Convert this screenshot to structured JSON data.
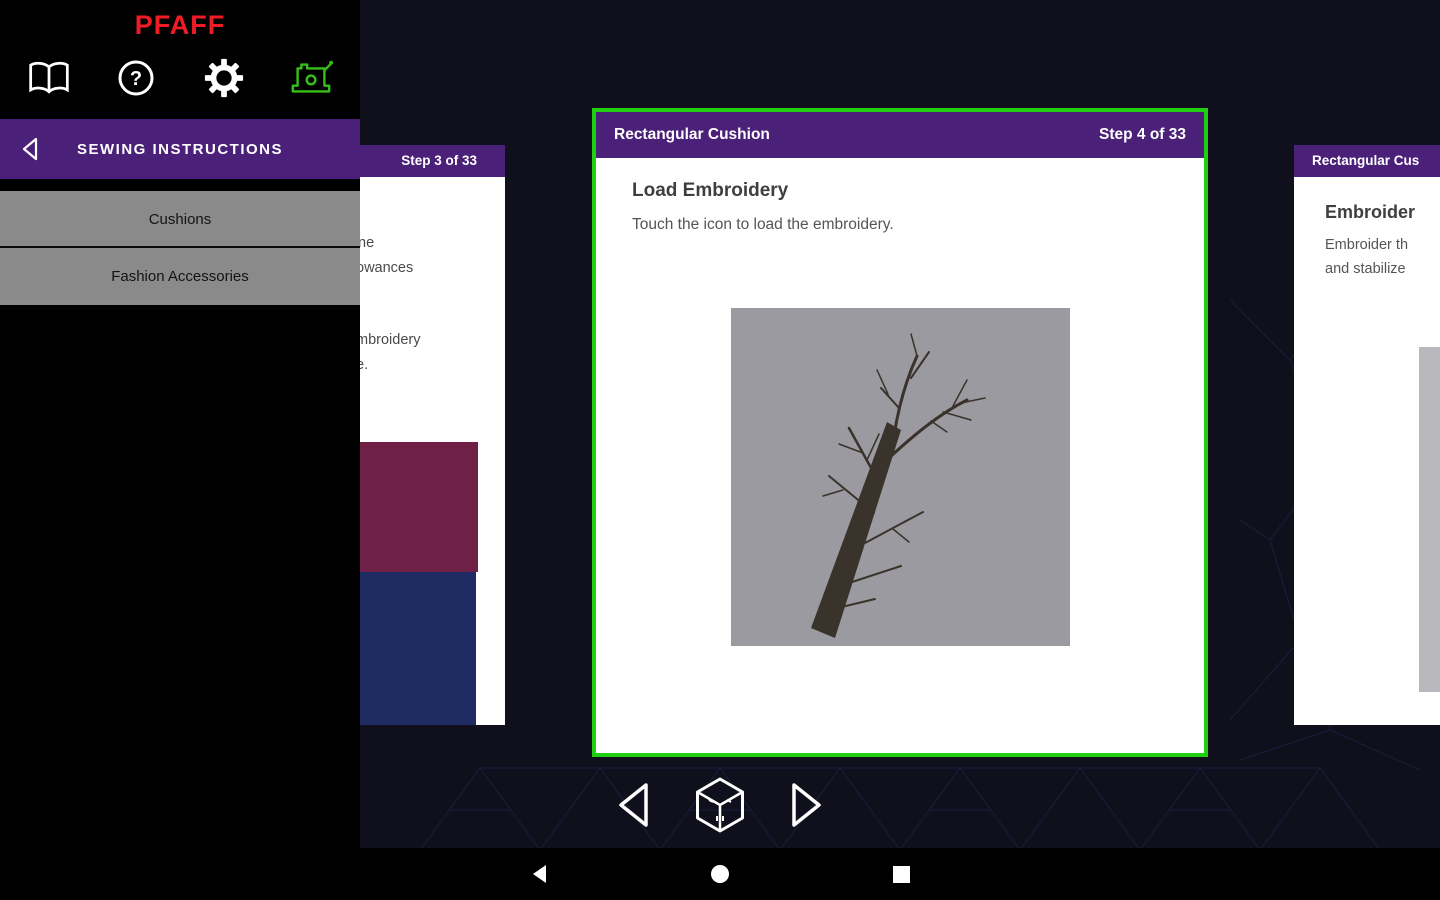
{
  "sidebar": {
    "logo": "PFAFF",
    "title": "SEWING INSTRUCTIONS",
    "menu": [
      "Cushions",
      "Fashion Accessories"
    ]
  },
  "card_prev": {
    "step": "Step 3 of 33",
    "fragments": [
      "ne",
      "owances",
      "mbroidery",
      "e."
    ]
  },
  "card_current": {
    "title": "Rectangular Cushion",
    "step": "Step 4 of 33",
    "heading": "Load Embroidery",
    "body": "Touch the icon to load the embroidery."
  },
  "card_next": {
    "title": "Rectangular Cus",
    "heading": "Embroider",
    "line1": "Embroider th",
    "line2": "and stabilize"
  },
  "colors": {
    "accent_green": "#20cf11",
    "header_purple": "#4b2079",
    "logo_red": "#ee1c25"
  }
}
